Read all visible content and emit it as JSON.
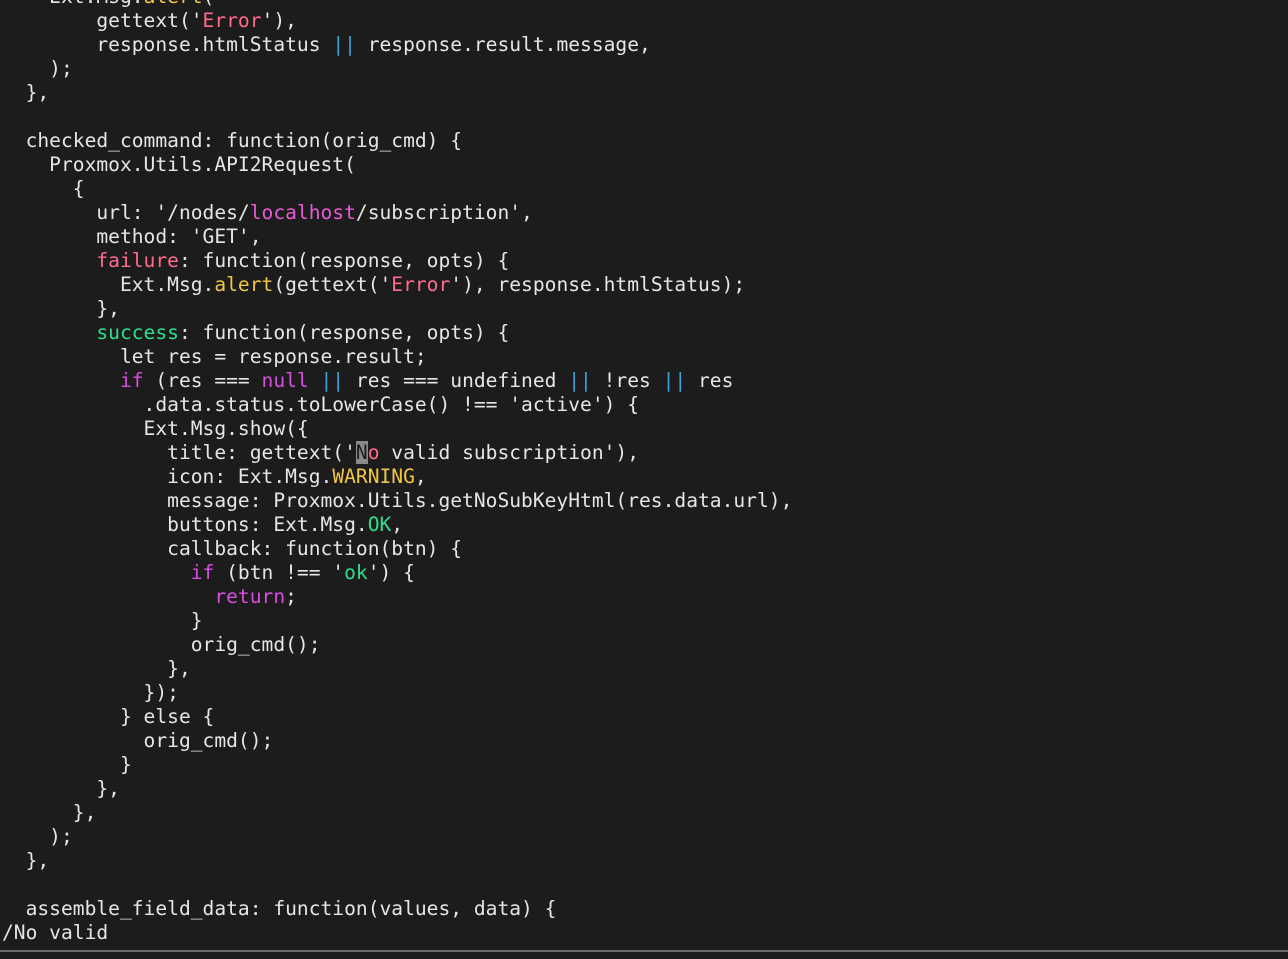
{
  "lines": [
    [
      {
        "t": "    Ext.Msg."
      },
      {
        "t": "alert",
        "c": "tok-yellow"
      },
      {
        "t": "("
      }
    ],
    [
      {
        "t": "        gettext('"
      },
      {
        "t": "Error",
        "c": "tok-err"
      },
      {
        "t": "'),"
      }
    ],
    [
      {
        "t": "        response.htmlStatus "
      },
      {
        "t": "||",
        "c": "tok-op"
      },
      {
        "t": " response.result.message,"
      }
    ],
    [
      {
        "t": "    );"
      }
    ],
    [
      {
        "t": "  },"
      }
    ],
    [
      {
        "t": ""
      }
    ],
    [
      {
        "t": "  checked_command: function(orig_cmd) {"
      }
    ],
    [
      {
        "t": "    Proxmox.Utils.API2Request("
      }
    ],
    [
      {
        "t": "      {"
      }
    ],
    [
      {
        "t": "        url: '/nodes/"
      },
      {
        "t": "localhost",
        "c": "tok-host"
      },
      {
        "t": "/subscription',"
      }
    ],
    [
      {
        "t": "        method: 'GET',"
      }
    ],
    [
      {
        "t": "        "
      },
      {
        "t": "failure",
        "c": "tok-fail"
      },
      {
        "t": ": function(response, opts) {"
      }
    ],
    [
      {
        "t": "          Ext.Msg."
      },
      {
        "t": "alert",
        "c": "tok-yellow"
      },
      {
        "t": "(gettext('"
      },
      {
        "t": "Error",
        "c": "tok-err"
      },
      {
        "t": "'), response.htmlStatus);"
      }
    ],
    [
      {
        "t": "        },"
      }
    ],
    [
      {
        "t": "        "
      },
      {
        "t": "success",
        "c": "tok-succ"
      },
      {
        "t": ": function(response, opts) {"
      }
    ],
    [
      {
        "t": "          let res = response.result;"
      }
    ],
    [
      {
        "t": "          "
      },
      {
        "t": "if",
        "c": "tok-kw"
      },
      {
        "t": " (res === "
      },
      {
        "t": "null",
        "c": "tok-null"
      },
      {
        "t": " "
      },
      {
        "t": "||",
        "c": "tok-op"
      },
      {
        "t": " res === undefined "
      },
      {
        "t": "||",
        "c": "tok-op"
      },
      {
        "t": " !res "
      },
      {
        "t": "||",
        "c": "tok-op"
      },
      {
        "t": " res"
      }
    ],
    [
      {
        "t": "            .data.status.toLowerCase() !== 'active') {"
      }
    ],
    [
      {
        "t": "            Ext.Msg.show({"
      }
    ],
    [
      {
        "t": "              title: gettext('"
      },
      {
        "t": "N",
        "c": "cursor"
      },
      {
        "t": "o",
        "c": "tok-err"
      },
      {
        "t": " valid subscription'),"
      }
    ],
    [
      {
        "t": "              icon: Ext.Msg."
      },
      {
        "t": "WARNING",
        "c": "tok-warn"
      },
      {
        "t": ","
      }
    ],
    [
      {
        "t": "              message: Proxmox.Utils.getNoSubKeyHtml(res.data.url),"
      }
    ],
    [
      {
        "t": "              buttons: Ext.Msg."
      },
      {
        "t": "OK",
        "c": "tok-ok"
      },
      {
        "t": ","
      }
    ],
    [
      {
        "t": "              callback: function(btn) {"
      }
    ],
    [
      {
        "t": "                "
      },
      {
        "t": "if",
        "c": "tok-kw"
      },
      {
        "t": " (btn !== '"
      },
      {
        "t": "ok",
        "c": "tok-ok"
      },
      {
        "t": "') {"
      }
    ],
    [
      {
        "t": "                  "
      },
      {
        "t": "return",
        "c": "tok-kw"
      },
      {
        "t": ";"
      }
    ],
    [
      {
        "t": "                }"
      }
    ],
    [
      {
        "t": "                orig_cmd();"
      }
    ],
    [
      {
        "t": "              },"
      }
    ],
    [
      {
        "t": "            });"
      }
    ],
    [
      {
        "t": "          } else {"
      }
    ],
    [
      {
        "t": "            orig_cmd();"
      }
    ],
    [
      {
        "t": "          }"
      }
    ],
    [
      {
        "t": "        },"
      }
    ],
    [
      {
        "t": "      },"
      }
    ],
    [
      {
        "t": "    );"
      }
    ],
    [
      {
        "t": "  },"
      }
    ],
    [
      {
        "t": ""
      }
    ],
    [
      {
        "t": "  assemble_field_data: function(values, data) {"
      }
    ]
  ],
  "command_line": "/No valid"
}
